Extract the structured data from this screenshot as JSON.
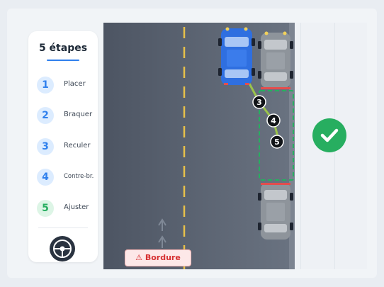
{
  "panel": {
    "title": "5 étapes",
    "steps": [
      {
        "num": "1",
        "label": "Placer"
      },
      {
        "num": "2",
        "label": "Braquer"
      },
      {
        "num": "3",
        "label": "Reculer"
      },
      {
        "num": "4",
        "label": "Contre-br."
      },
      {
        "num": "5",
        "label": "Ajuster"
      }
    ]
  },
  "scene": {
    "markers": [
      "3",
      "4",
      "5"
    ],
    "warning_badge": "⚠ Bordure"
  },
  "status": {
    "completed": true
  },
  "colors": {
    "accent_blue": "#2f80ed",
    "success_green": "#27ae60",
    "road": "#5c6675",
    "lane_yellow": "#e7c04a",
    "player_car": "#2f6fe0",
    "parked_car": "#8e949b",
    "warning_red": "#d63031"
  }
}
